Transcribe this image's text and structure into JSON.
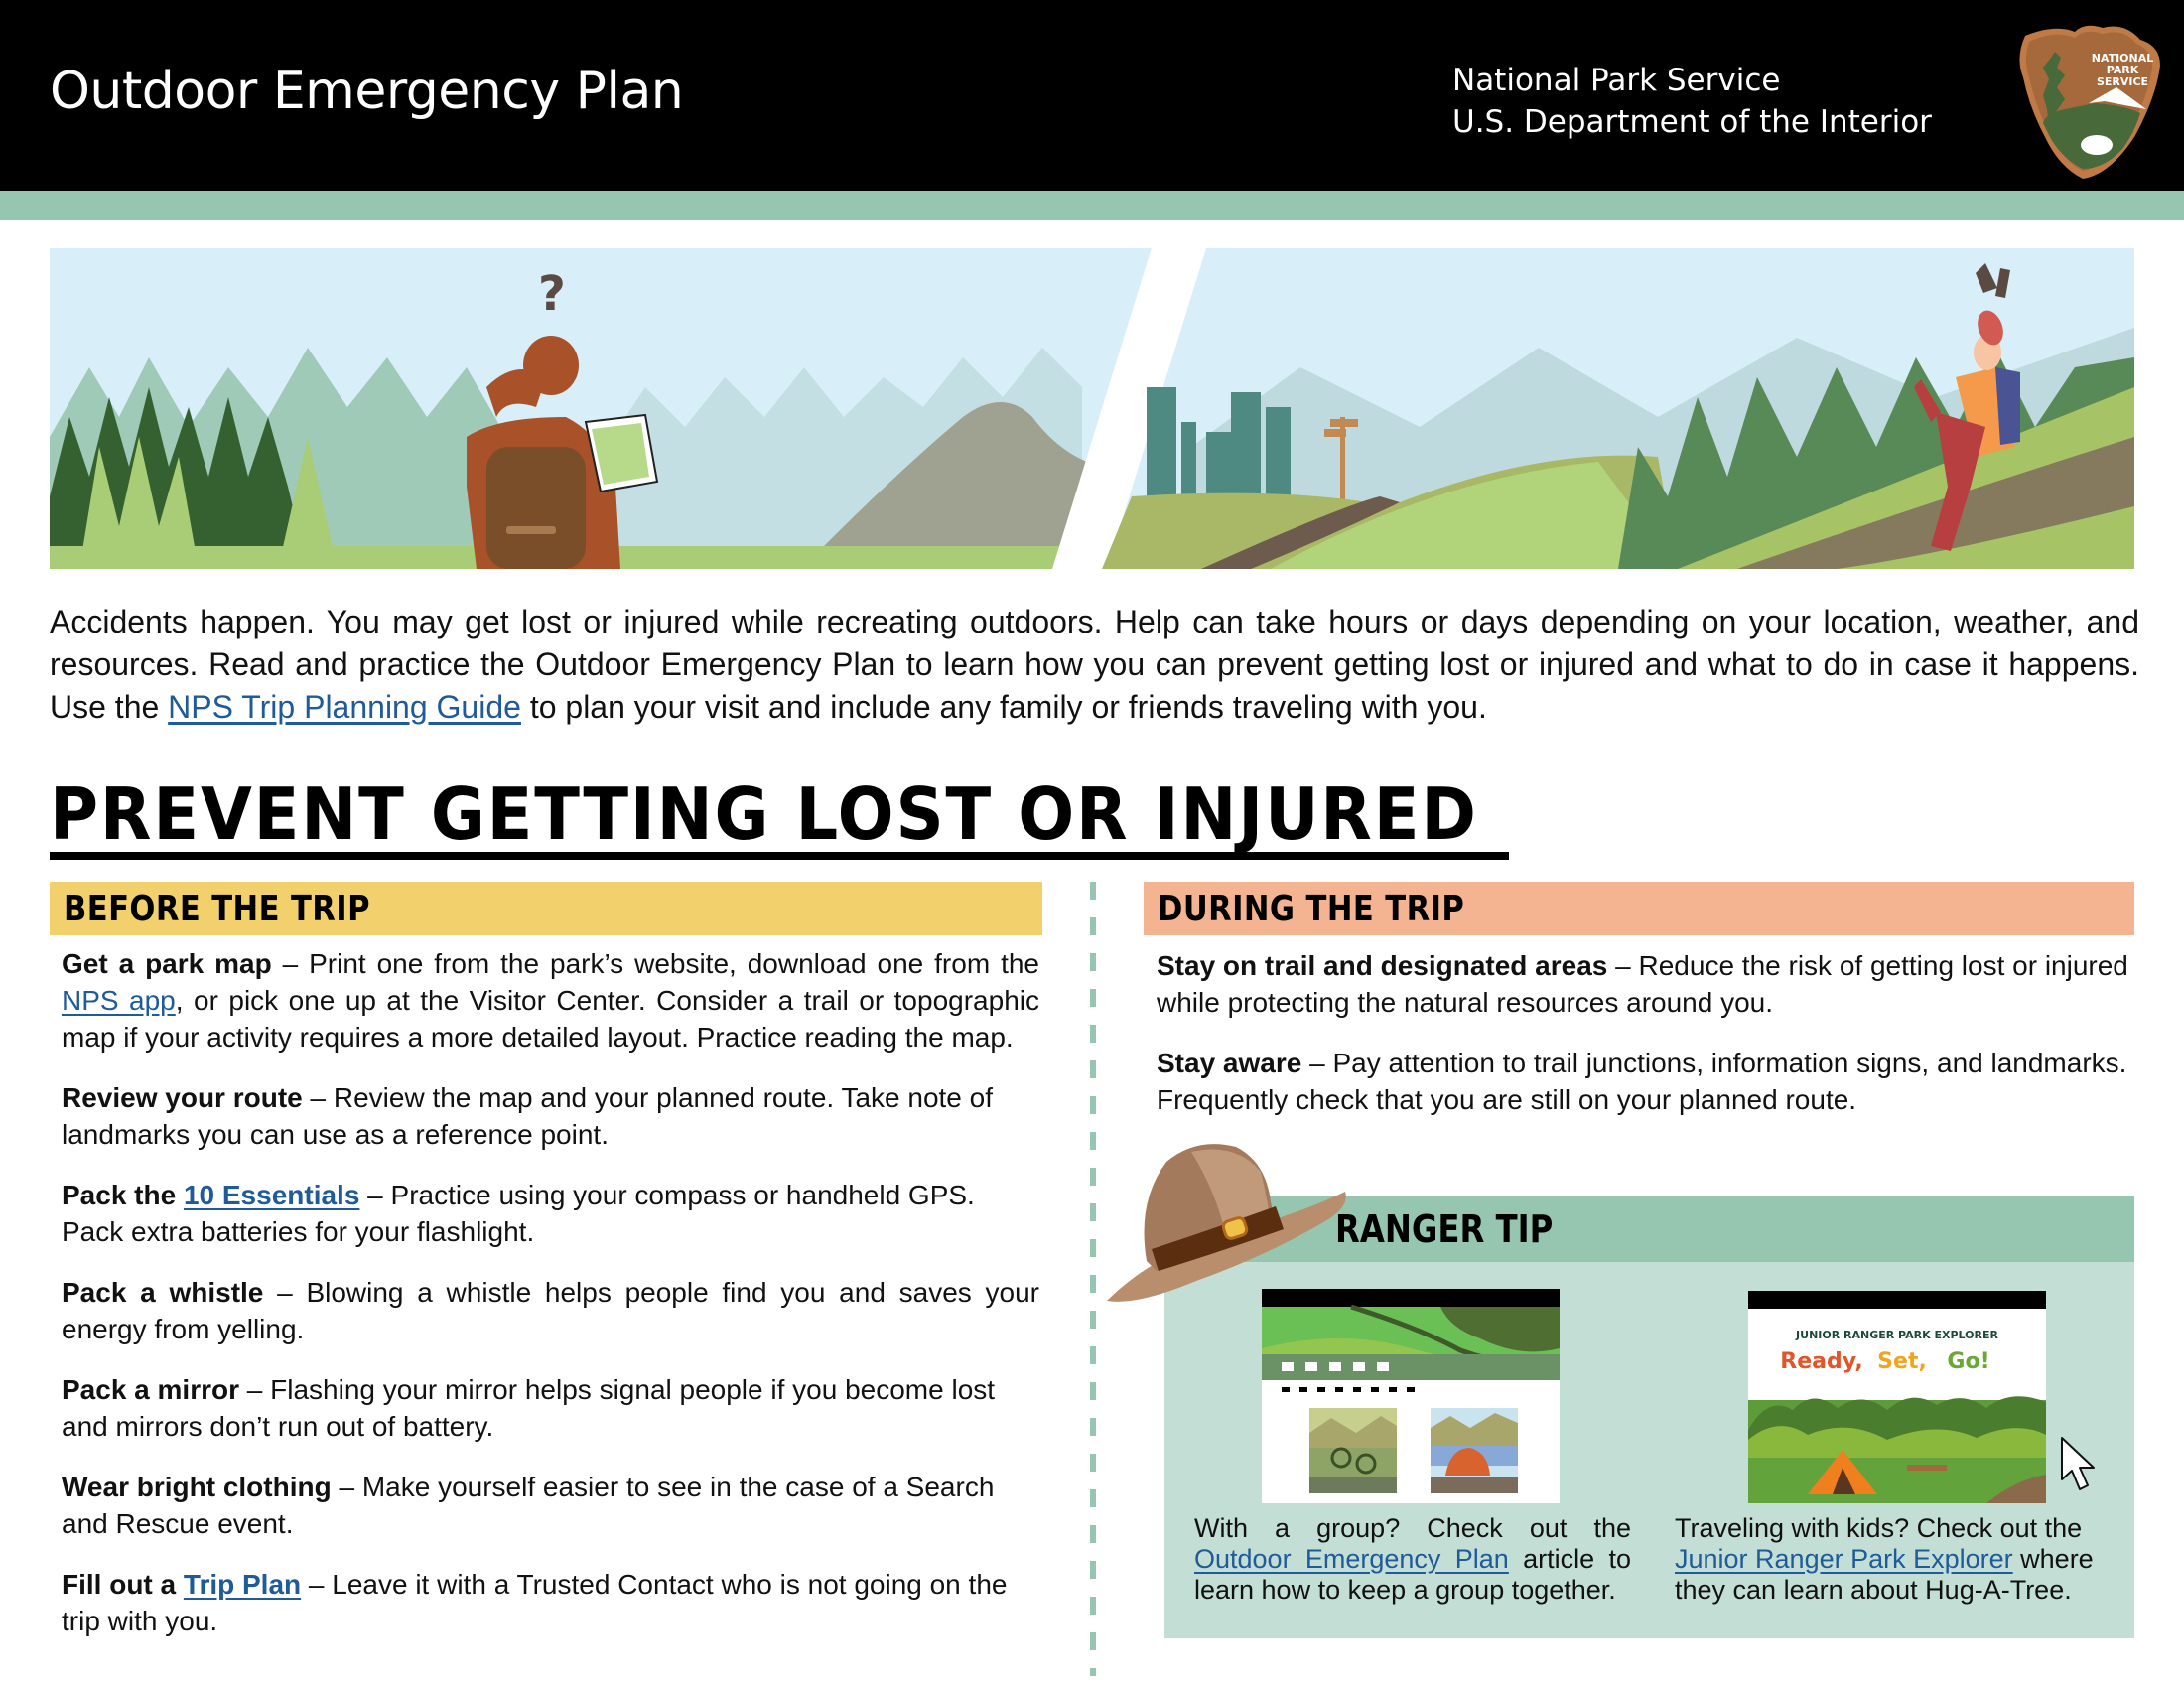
{
  "header": {
    "title": "Outdoor Emergency Plan",
    "agency_line1": "National Park Service",
    "agency_line2": "U.S. Department of the Interior",
    "logo_text": [
      "NATIONAL",
      "PARK",
      "SERVICE"
    ],
    "logo_icon": "nps-arrowhead-icon"
  },
  "colors": {
    "header_bg": "#000000",
    "accent_green": "#96c5b0",
    "tip_bg": "#c2ded5",
    "before_header": "#f2d06b",
    "during_header": "#f4b491",
    "link": "#1f5a99"
  },
  "banner": {
    "left_scene": "Hiker with backpack scratching head while looking at a map",
    "left_mark": "?",
    "right_scene": "Hiker slipping and falling on a trail slope"
  },
  "intro": {
    "text_before_link": "Accidents happen. You may get lost or injured while recreating outdoors. Help can take hours or days depending on your location, weather, and resources. Read and practice the Outdoor Emergency Plan to learn how you can prevent getting lost or injured and what to do in case it happens. Use the ",
    "link_label": "NPS Trip Planning Guide",
    "text_after_link": " to plan your visit and include any family or friends traveling with you."
  },
  "main_title": "PREVENT GETTING LOST OR INJURED",
  "before_trip": {
    "heading": "BEFORE THE TRIP",
    "items": [
      {
        "title": "Get a park map",
        "pre": " – Print one from the park’s website, download one from the ",
        "link": "NPS app",
        "post": ", or pick one up at the Visitor Center. Consider a trail or topographic map if your activity requires a more detailed layout. Practice reading the map."
      },
      {
        "title": "Review your route",
        "text": " – Review the map and your planned route. Take note of landmarks you can use as a reference point."
      },
      {
        "title": "Pack the ",
        "link": "10 Essentials",
        "text": " – Practice using your compass or handheld GPS. Pack extra batteries for your flashlight."
      },
      {
        "title": "Pack a whistle",
        "text": " – Blowing a whistle helps people find you and saves your energy from yelling."
      },
      {
        "title": "Pack a mirror",
        "text": " – Flashing your mirror helps signal people if you become lost and mirrors don’t run out of battery."
      },
      {
        "title": "Wear bright clothing",
        "text": " – Make yourself easier to see in the case of a Search and Rescue event."
      },
      {
        "title": "Fill out a ",
        "link": "Trip Plan",
        "text": " – Leave it with a Trusted Contact who is not going on the trip with you."
      }
    ]
  },
  "during_trip": {
    "heading": "DURING THE TRIP",
    "items": [
      {
        "title": "Stay on trail and designated areas",
        "text": " – Reduce the risk of getting lost or injured while protecting the natural resources around you."
      },
      {
        "title": "Stay aware",
        "text": " – Pay attention to trail junctions, information signs, and landmarks. Frequently check that you are still on your planned route."
      }
    ]
  },
  "ranger_tip": {
    "heading": "RANGER TIP",
    "group": {
      "pre": "With a group? Check out the ",
      "link": "Outdoor Emergency Plan",
      "post": " article to learn how to keep a group together."
    },
    "kids": {
      "pre": "Traveling with kids? Check out the ",
      "link": "Junior Ranger Park Explorer",
      "post": " where they can learn about Hug-A-Tree."
    },
    "kids_thumb": {
      "kicker": "JUNIOR RANGER PARK EXPLORER",
      "title_words": [
        "Ready,",
        "Set,",
        "Go!"
      ]
    }
  }
}
